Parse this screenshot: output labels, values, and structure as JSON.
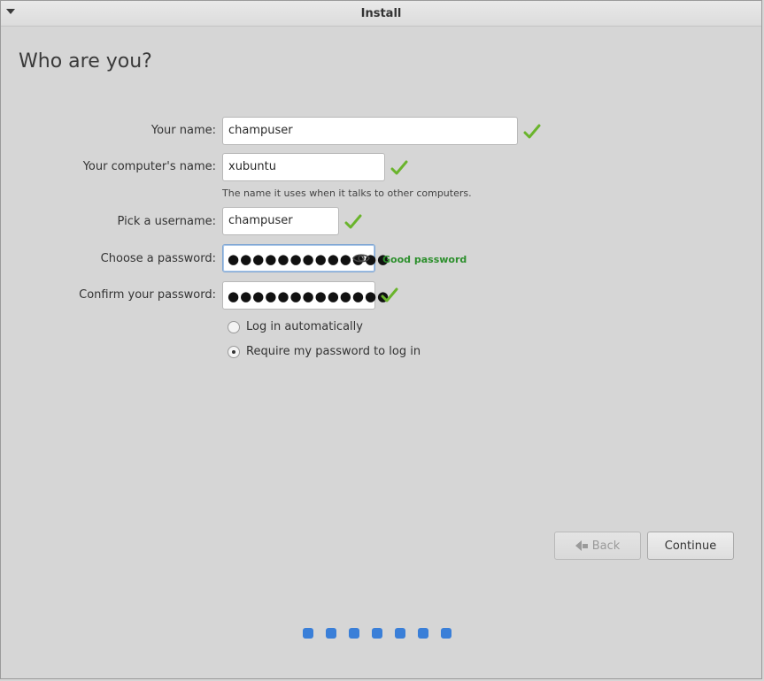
{
  "window": {
    "title": "Install"
  },
  "page": {
    "heading": "Who are you?"
  },
  "form": {
    "name_label": "Your name:",
    "name_value": "champuser",
    "computer_label": "Your computer's name:",
    "computer_value": "xubuntu",
    "computer_hint": "The name it uses when it talks to other computers.",
    "username_label": "Pick a username:",
    "username_value": "champuser",
    "password_label": "Choose a password:",
    "password_value": "●●●●●●●●●●●●●",
    "password_strength": "Good password",
    "confirm_label": "Confirm your password:",
    "confirm_value": "●●●●●●●●●●●●●",
    "login_options": [
      {
        "label": "Log in automatically",
        "selected": false
      },
      {
        "label": "Require my password to log in",
        "selected": true
      }
    ]
  },
  "buttons": {
    "back_label": "Back",
    "continue_label": "Continue"
  },
  "progress": {
    "steps": 7
  },
  "colors": {
    "check": "#6ab42c",
    "progress": "#3a7fd8",
    "strength": "#2c8f2c"
  }
}
